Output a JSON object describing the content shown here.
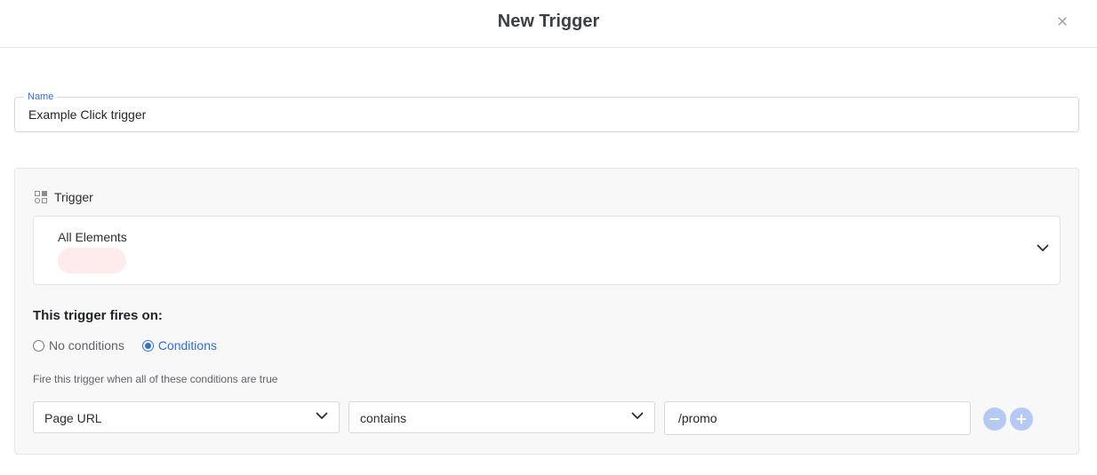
{
  "dialog": {
    "title": "New Trigger",
    "close_icon": "close-icon"
  },
  "name_field": {
    "label": "Name",
    "value": "Example Click trigger"
  },
  "trigger": {
    "section_label": "Trigger",
    "section_icon": "widgets-icon",
    "selected": "All Elements",
    "badge_color": "#fdeceb"
  },
  "fires_on": {
    "heading": "This trigger fires on:",
    "options": [
      {
        "label": "No conditions",
        "checked": false
      },
      {
        "label": "Conditions",
        "checked": true
      }
    ],
    "hint": "Fire this trigger when all of these conditions are true"
  },
  "condition": {
    "variable": "Page URL",
    "operator": "contains",
    "value": "/promo"
  },
  "colors": {
    "accent": "#2f6fd8",
    "action_button": "#b4c9f4"
  }
}
